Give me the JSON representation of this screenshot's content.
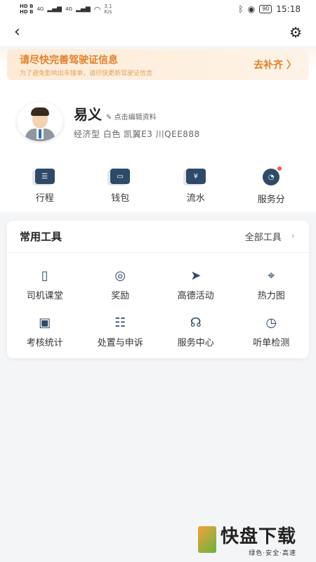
{
  "status_bar": {
    "sim1": "HD B",
    "sim2": "HD B",
    "net1": "4G",
    "net2": "4G",
    "speed_value": "3.1",
    "speed_unit": "K/s",
    "battery": "90",
    "time": "15:18",
    "icons": [
      "bluetooth-icon",
      "location-icon",
      "battery-icon",
      "wifi-icon",
      "signal-icon"
    ]
  },
  "topbar": {
    "back_icon": "back-arrow-icon",
    "settings_icon": "gear-icon"
  },
  "banner": {
    "title": "请尽快完善驾驶证信息",
    "subtitle": "为了避免影响出车接单，请尽快更新驾驶证信息",
    "action": "去补齐 〉"
  },
  "profile": {
    "name": "易义",
    "edit_label": "点击编辑资料",
    "car_info": "经济型 白色 凯翼E3  川QEE888"
  },
  "quick_actions": [
    {
      "label": "行程",
      "icon": "trip-icon"
    },
    {
      "label": "钱包",
      "icon": "wallet-icon"
    },
    {
      "label": "流水",
      "icon": "statement-icon"
    },
    {
      "label": "服务分",
      "icon": "service-score-icon",
      "badge": true
    }
  ],
  "tools": {
    "title": "常用工具",
    "all_label": "全部工具",
    "items": [
      {
        "label": "司机课堂",
        "icon": "book-icon"
      },
      {
        "label": "奖励",
        "icon": "medal-icon"
      },
      {
        "label": "高德活动",
        "icon": "paper-plane-icon"
      },
      {
        "label": "热力图",
        "icon": "map-pin-icon"
      },
      {
        "label": "考核统计",
        "icon": "chart-icon"
      },
      {
        "label": "处置与申诉",
        "icon": "message-icon"
      },
      {
        "label": "服务中心",
        "icon": "headset-icon"
      },
      {
        "label": "听单检测",
        "icon": "gauge-icon"
      }
    ]
  },
  "watermark": {
    "big": "快盘下载",
    "small": "绿色·安全·高速"
  },
  "colors": {
    "accent_orange": "#e0822c",
    "icon_navy": "#2f4a68",
    "badge_red": "#f45a4a"
  }
}
